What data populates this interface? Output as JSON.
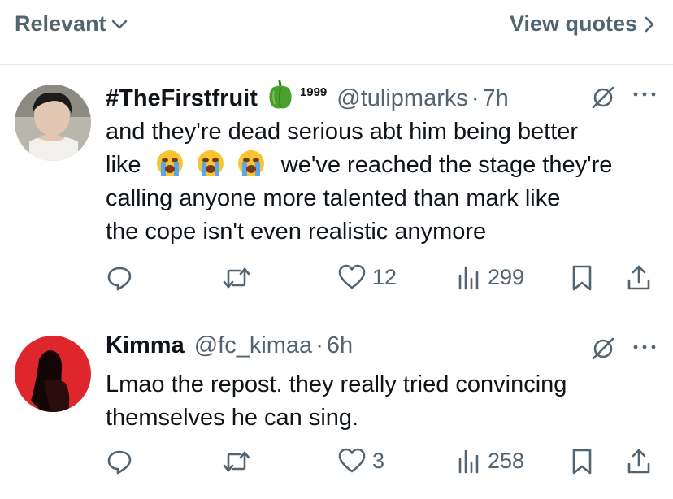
{
  "header": {
    "sort_label": "Relevant",
    "quotes_label": "View quotes"
  },
  "posts": [
    {
      "display_name": "#TheFirstfruit",
      "name_emoji": "green-bell-pepper",
      "name_suffix": "1999",
      "handle": "@tulipmarks",
      "separator": "·",
      "time": "7h",
      "text_line1": "and they're dead serious abt him being better",
      "text_line2_pre": "like",
      "text_emojis": [
        "loudly-crying-face",
        "loudly-crying-face",
        "loudly-crying-face"
      ],
      "text_line2_post": "we've reached the stage they're",
      "text_line3": "calling anyone more talented than mark like",
      "text_line4": "the cope isn't even realistic anymore",
      "replies": "",
      "reposts": "",
      "likes": "12",
      "views": "299"
    },
    {
      "display_name": "Kimma",
      "handle": "@fc_kimaa",
      "separator": "·",
      "time": "6h",
      "text_line1": "Lmao the repost. they really tried convincing",
      "text_line2": "themselves he can sing.",
      "replies": "",
      "reposts": "",
      "likes": "3",
      "views": "258"
    }
  ],
  "colors": {
    "text": "#0f1419",
    "muted": "#536471",
    "divider": "#e6e9ec",
    "avatar2_bg": "#e0262d"
  }
}
